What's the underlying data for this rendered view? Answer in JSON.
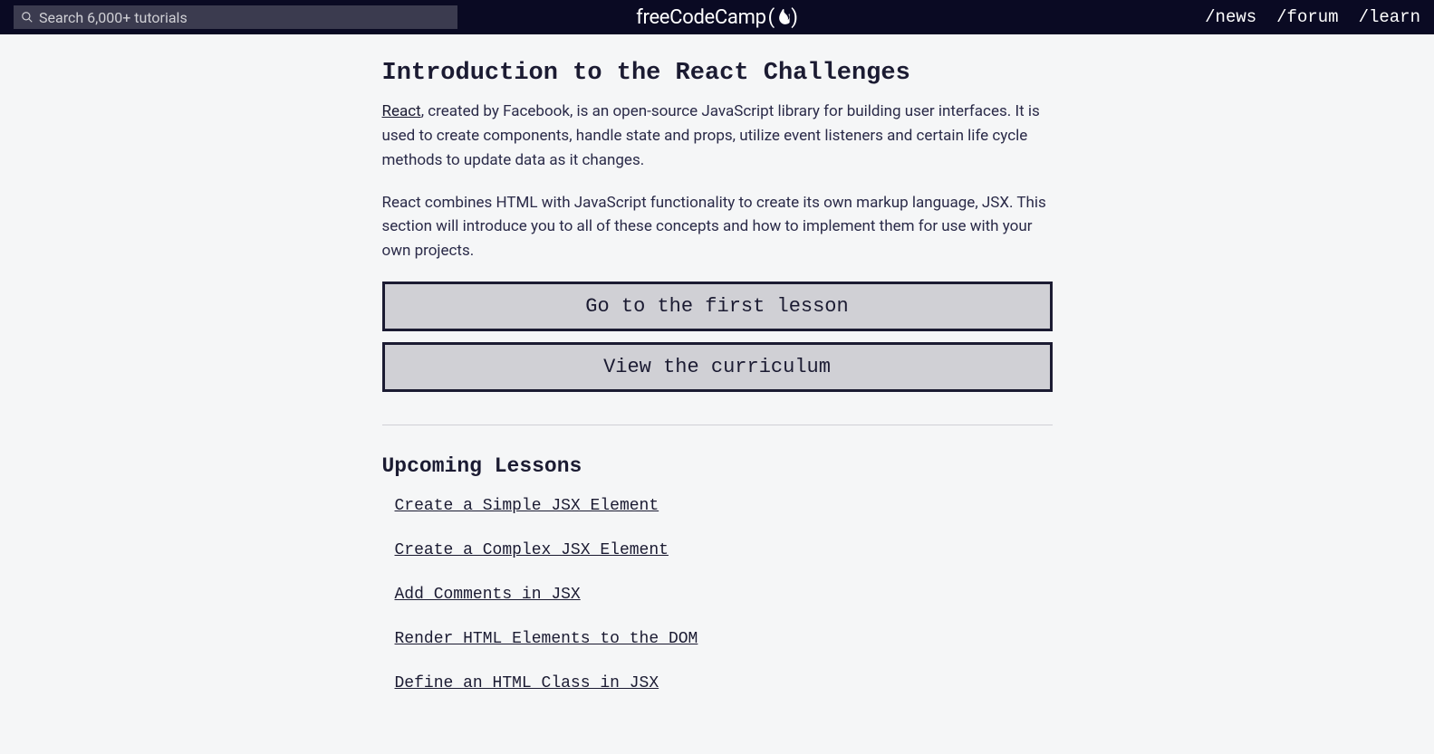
{
  "nav": {
    "search_placeholder": "Search 6,000+ tutorials",
    "logo": "freeCodeCamp",
    "links": [
      "/news",
      "/forum",
      "/learn"
    ]
  },
  "page": {
    "title": "Introduction to the React Challenges",
    "react_link_text": "React",
    "intro_p1_rest": ", created by Facebook, is an open-source JavaScript library for building user interfaces. It is used to create components, handle state and props, utilize event listeners and certain life cycle methods to update data as it changes.",
    "intro_p2": "React combines HTML with JavaScript functionality to create its own markup language, JSX. This section will introduce you to all of these concepts and how to implement them for use with your own projects.",
    "cta_first_lesson": "Go to the first lesson",
    "cta_curriculum": "View the curriculum",
    "upcoming_title": "Upcoming Lessons",
    "lessons": [
      "Create a Simple JSX Element",
      "Create a Complex JSX Element",
      "Add Comments in JSX",
      "Render HTML Elements to the DOM",
      "Define an HTML Class in JSX"
    ]
  }
}
